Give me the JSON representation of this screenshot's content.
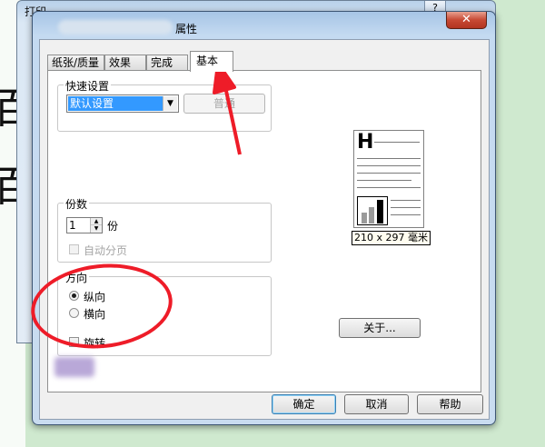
{
  "background": {
    "glyphs": [
      "百",
      "百"
    ]
  },
  "print_window": {
    "title": "打印",
    "help_button": "?"
  },
  "dialog": {
    "title": "属性",
    "close_button": "✕",
    "tabs": [
      {
        "label": "纸张/质量",
        "active": false
      },
      {
        "label": "效果",
        "active": false
      },
      {
        "label": "完成",
        "active": false
      },
      {
        "label": "基本",
        "active": true
      }
    ],
    "quick_settings": {
      "legend": "快速设置",
      "selected": "默认设置",
      "save_button": "普通"
    },
    "copies": {
      "legend": "份数",
      "value": "1",
      "unit": "份",
      "collate_label": "自动分页",
      "collate_checked": false,
      "collate_enabled": false
    },
    "orientation": {
      "legend": "方向",
      "options": [
        {
          "label": "纵向",
          "checked": true
        },
        {
          "label": "横向",
          "checked": false
        }
      ],
      "rotate_label": "旋转",
      "rotate_checked": false
    },
    "preview": {
      "heading_glyph": "H",
      "size_label": "210 x 297 毫米"
    },
    "about_button": "关于...",
    "footer_buttons": {
      "ok": "确定",
      "cancel": "取消",
      "help": "帮助"
    }
  },
  "annotations": {
    "color": "#ee1c28"
  }
}
